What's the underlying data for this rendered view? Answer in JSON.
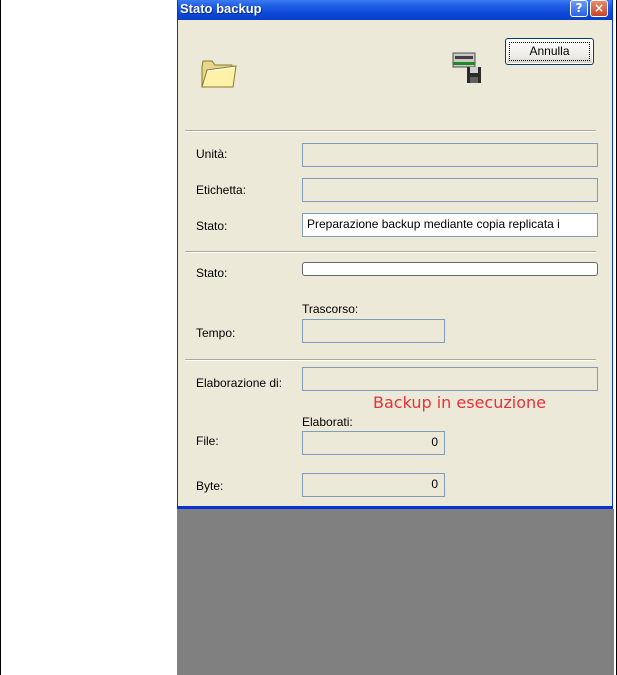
{
  "window": {
    "title": "Stato backup",
    "help_label": "?",
    "close_label": "×"
  },
  "icons": {
    "folder": "folder-icon",
    "floppy": "floppy-drive-icon"
  },
  "buttons": {
    "cancel_label": "Annulla"
  },
  "device_info": {
    "unit_label": "Unità:",
    "unit_value": "",
    "label_label": "Etichetta:",
    "label_value": "",
    "status_label": "Stato:",
    "status_value": "Preparazione backup mediante copia replicata i"
  },
  "progress": {
    "status_label": "Stato:",
    "fraction": 0,
    "elapsed_label": "Trascorso:",
    "time_label": "Tempo:",
    "time_value": ""
  },
  "processing": {
    "processing_of_label": "Elaborazione di:",
    "processing_of_value": "",
    "overlay_text": "Backup in esecuzione",
    "processed_label": "Elaborati:",
    "file_label": "File:",
    "file_value": "0",
    "byte_label": "Byte:",
    "byte_value": "0"
  },
  "colors": {
    "titlebar": "#0b47d6",
    "dialog_bg": "#ece9d8",
    "overlay_text": "#e8303a",
    "desktop": "#808080"
  }
}
